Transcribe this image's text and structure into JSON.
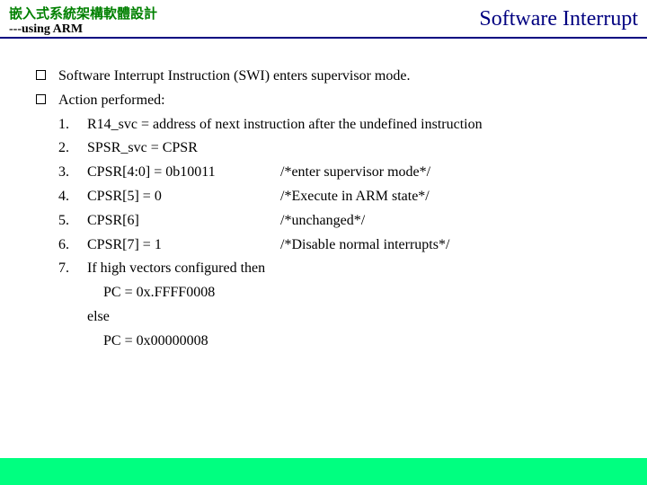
{
  "header": {
    "course_title": "嵌入式系統架構軟體設計",
    "subtitle": "---using ARM",
    "page_title": "Software Interrupt"
  },
  "bullets": {
    "b1": "Software Interrupt Instruction (SWI) enters supervisor mode.",
    "b2": "Action performed:"
  },
  "steps": {
    "n1": "1.",
    "n2": "2.",
    "n3": "3.",
    "n4": "4.",
    "n5": "5.",
    "n6": "6.",
    "n7": "7.",
    "t1": "R14_svc = address of next instruction after the undefined instruction",
    "t2": "SPSR_svc = CPSR",
    "t3a": "CPSR[4:0] = 0b10011",
    "t3b": "/*enter supervisor mode*/",
    "t4a": "CPSR[5] = 0",
    "t4b": "/*Execute in ARM state*/",
    "t5a": "CPSR[6]",
    "t5b": "/*unchanged*/",
    "t6a": "CPSR[7] = 1",
    "t6b": "/*Disable normal interrupts*/",
    "t7": "If high vectors configured then"
  },
  "sub": {
    "l1": "PC = 0x.FFFF0008",
    "l2": "else",
    "l3": "PC = 0x00000008"
  }
}
